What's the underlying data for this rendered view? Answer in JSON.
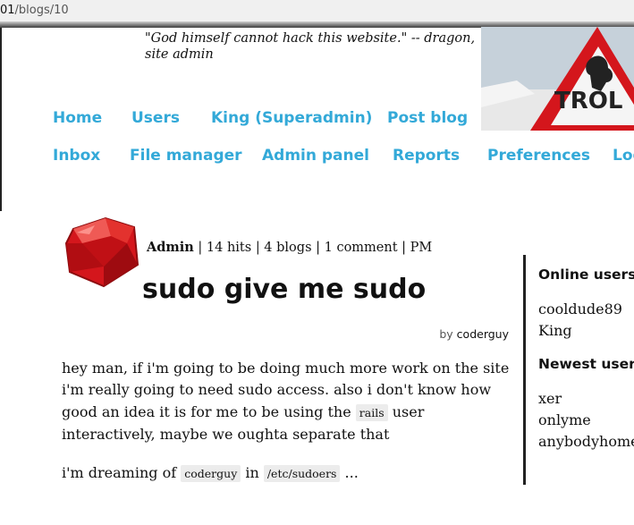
{
  "address_bar": {
    "host_fragment": "01",
    "path": "/blogs/10"
  },
  "header": {
    "quote": "\"God himself cannot hack this website.\" -- dragon, site admin",
    "banner_sign_text": "TROL",
    "nav": [
      {
        "label": "Home"
      },
      {
        "label": "Users"
      },
      {
        "label": "King (Superadmin)"
      },
      {
        "label": "Post blog"
      },
      {
        "label": "Inbox"
      },
      {
        "label": "File manager"
      },
      {
        "label": "Admin panel"
      },
      {
        "label": "Reports"
      },
      {
        "label": "Preferences"
      },
      {
        "label": "Log"
      }
    ]
  },
  "post": {
    "author_name": "Admin",
    "author_stats": " | 14 hits | 4 blogs | 1 comment | PM",
    "title": "sudo give me sudo",
    "byline_prefix": "by ",
    "byline_author": "coderguy",
    "paragraph1_before": "hey man, if i'm going to be doing much more work on the site i'm really going to need sudo access. also i don't know how good an idea it is for me to be using the ",
    "paragraph1_tag": "rails",
    "paragraph1_after": " user interactively, maybe we oughta separate that",
    "paragraph2_before": "i'm dreaming of ",
    "paragraph2_tag1": "coderguy",
    "paragraph2_mid": " in ",
    "paragraph2_tag2": "/etc/sudoers",
    "paragraph2_after": " ..."
  },
  "sidebar": {
    "online_heading": "Online users",
    "online_users": [
      "cooldude89",
      "King"
    ],
    "newest_heading": "Newest users",
    "newest_users": [
      "xer",
      "onlyme",
      "anybodyhome"
    ]
  },
  "colors": {
    "link": "#33a9d8",
    "ruby_red": "#d4161c"
  }
}
